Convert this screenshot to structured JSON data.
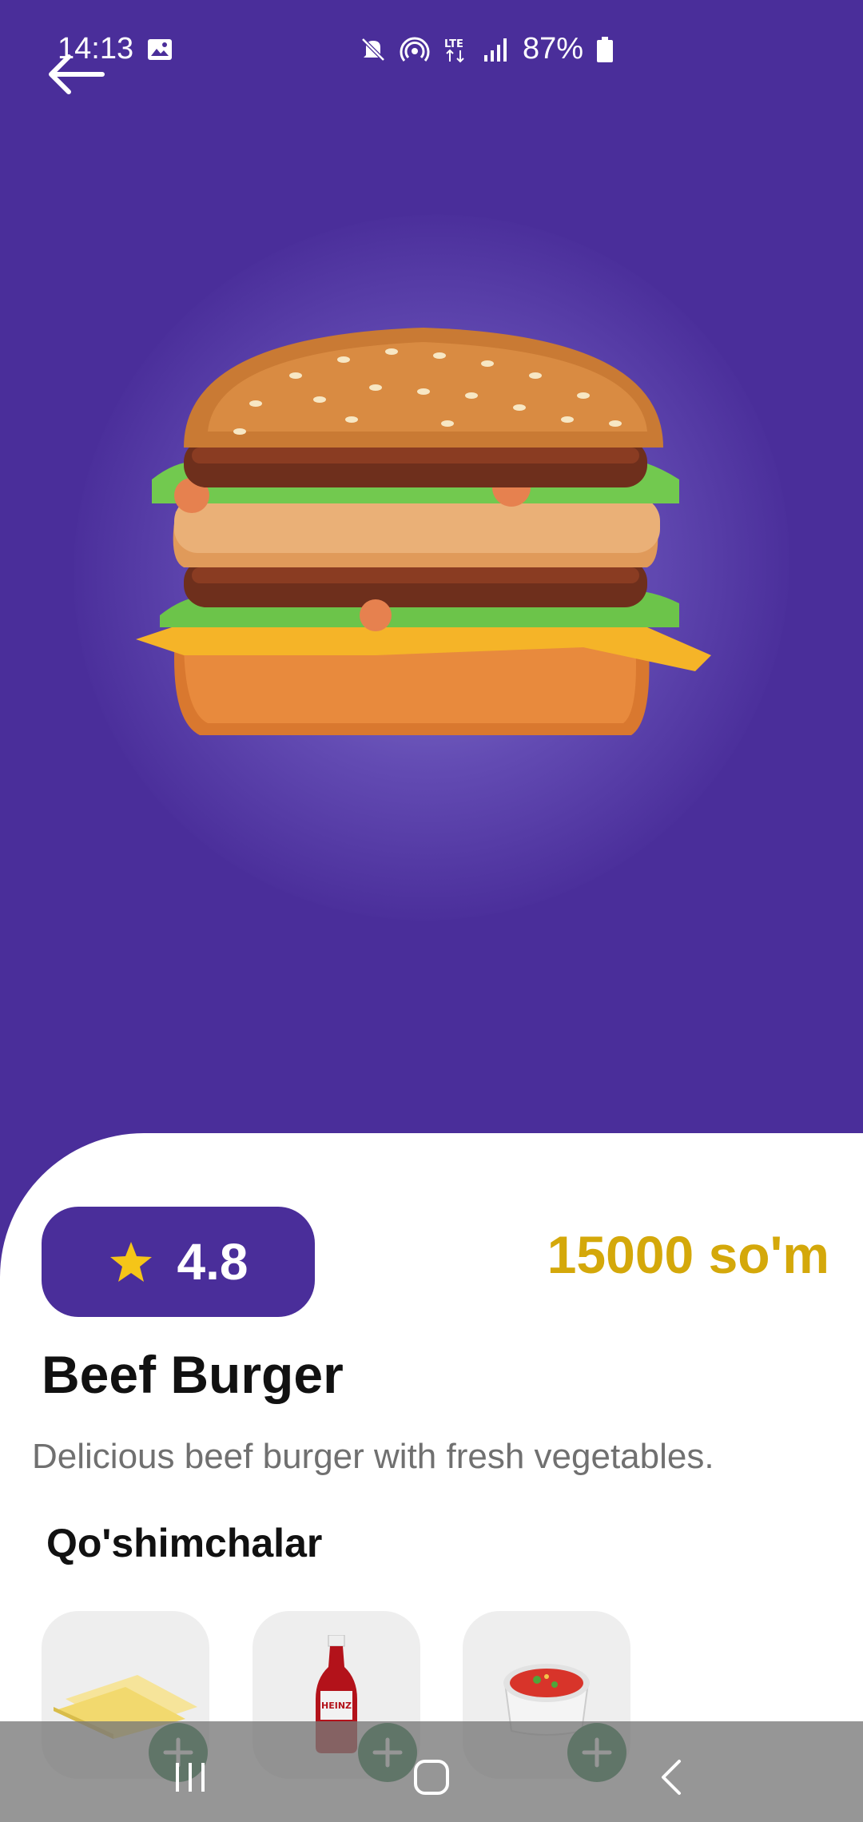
{
  "status_bar": {
    "time": "14:13",
    "battery": "87%",
    "icons": [
      "gallery-icon",
      "mute-icon",
      "hotspot-icon",
      "lte-icon",
      "signal-icon",
      "battery-icon"
    ]
  },
  "product": {
    "rating": "4.8",
    "price": "15000 so'm",
    "name": "Beef Burger",
    "description": "Delicious beef burger with fresh vegetables."
  },
  "addons": {
    "title": "Qo'shimchalar",
    "items": [
      {
        "icon": "cheese-slices-icon"
      },
      {
        "icon": "ketchup-bottle-icon"
      },
      {
        "icon": "salsa-bowl-icon"
      }
    ]
  },
  "nav": {
    "items": [
      "recent-apps-icon",
      "home-icon",
      "back-nav-icon"
    ]
  },
  "colors": {
    "primary": "#4a2e9a",
    "price": "#d4a80a",
    "add_button": "#0c6b2f",
    "star": "#f5c518"
  }
}
